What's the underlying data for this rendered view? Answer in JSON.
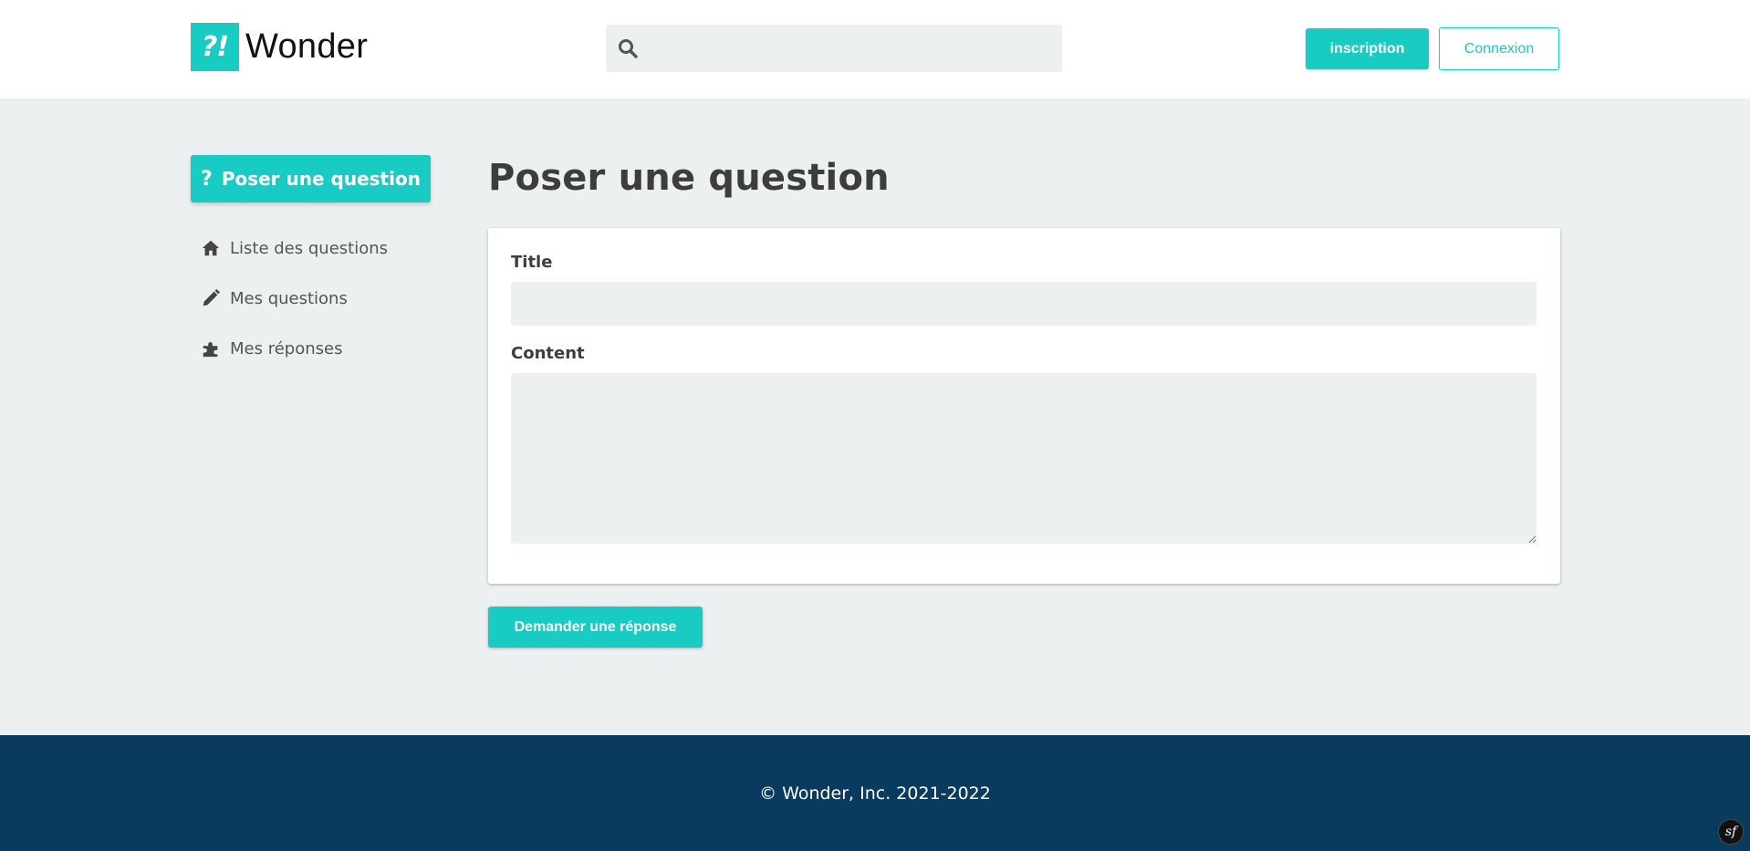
{
  "header": {
    "logo_mark": "?!",
    "logo_text": "Wonder",
    "search_placeholder": "",
    "search_icon": "search-icon",
    "signup_label": "inscription",
    "login_label": "Connexion"
  },
  "sidebar": {
    "ask_button_icon": "?",
    "ask_button_label": "Poser une question",
    "items": [
      {
        "label": "Liste des questions",
        "icon": "home-icon"
      },
      {
        "label": "Mes questions",
        "icon": "pencil-icon"
      },
      {
        "label": "Mes réponses",
        "icon": "puzzle-icon"
      }
    ]
  },
  "main": {
    "title": "Poser une question",
    "form": {
      "title_label": "Title",
      "title_value": "",
      "content_label": "Content",
      "content_value": ""
    },
    "submit_label": "Demander une réponse"
  },
  "footer": {
    "copyright": "© Wonder, Inc. 2021-2022",
    "badge": "sf"
  },
  "colors": {
    "accent": "#18ccc4",
    "background": "#ecf0f1",
    "footer": "#093b5e",
    "text": "#3d3d3d"
  }
}
